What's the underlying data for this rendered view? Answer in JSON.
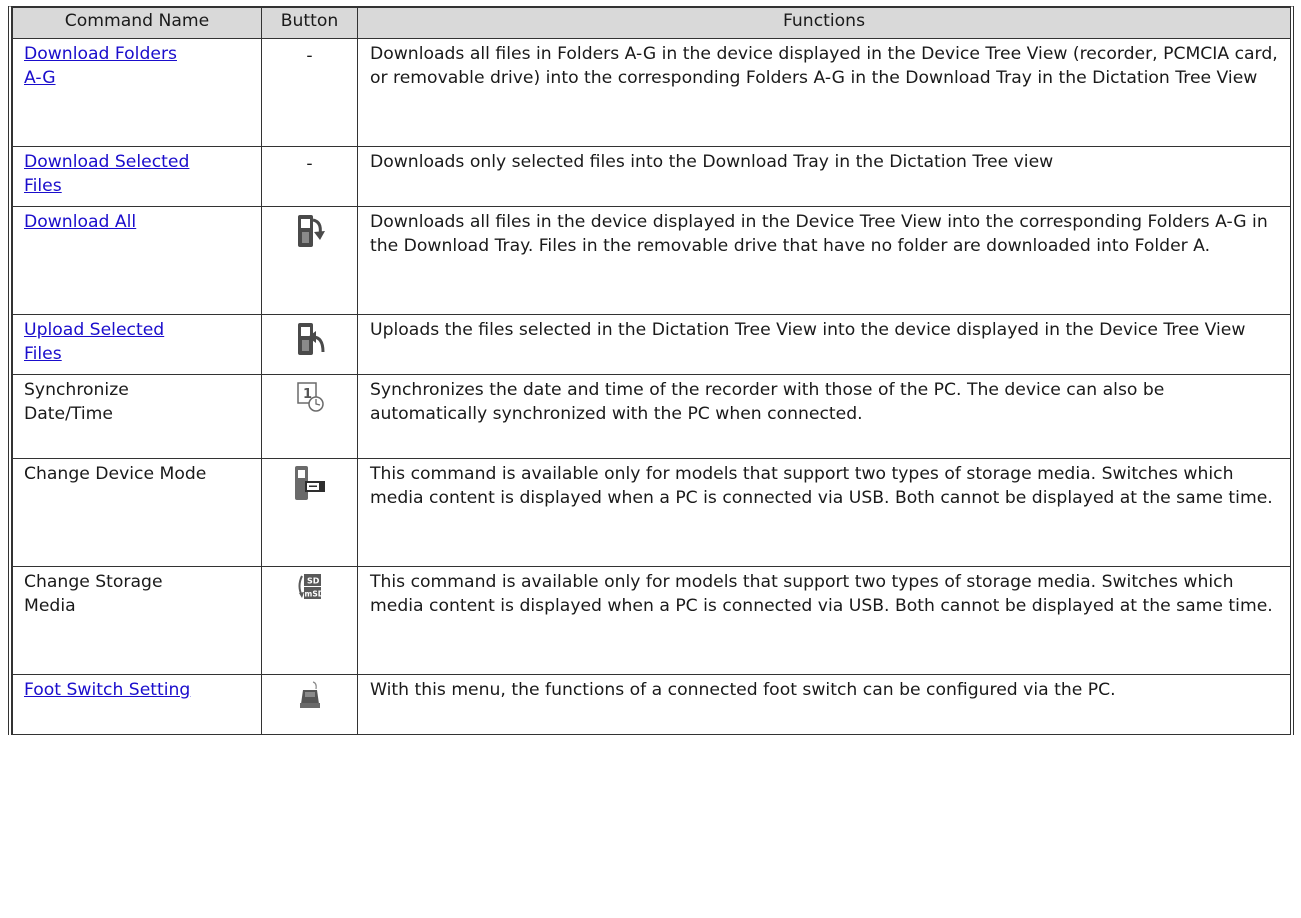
{
  "headers": {
    "command": "Command Name",
    "button": "Button",
    "functions": "Functions"
  },
  "rows": [
    {
      "name": "Download Folders A-G",
      "name_lines": [
        "Download Folders ",
        "A-G"
      ],
      "link": true,
      "button": "-",
      "icon": "none",
      "function": "Downloads all files in Folders A-G in the device displayed in the Device Tree View (recorder, PCMCIA card, or removable drive) into the corresponding Folders A-G in the Download Tray in the Dictation Tree View"
    },
    {
      "name": "Download Selected Files",
      "name_lines": [
        "Download Selected ",
        "Files"
      ],
      "link": true,
      "button": "-",
      "icon": "none",
      "function": "Downloads only selected files into the Download Tray in the Dictation Tree view"
    },
    {
      "name": "Download All",
      "name_lines": [
        "Download All"
      ],
      "link": true,
      "button": "",
      "icon": "download-all-icon",
      "function": "Downloads all files in the device displayed in the Device Tree View into the corresponding Folders A-G in the Download Tray. Files in the removable drive that have no folder are downloaded into Folder A."
    },
    {
      "name": "Upload Selected Files",
      "name_lines": [
        "Upload Selected ",
        "Files"
      ],
      "link": true,
      "button": "",
      "icon": "upload-selected-icon",
      "function": "Uploads the files selected in the Dictation Tree View into the device displayed in the Device Tree View"
    },
    {
      "name": "Synchronize Date/Time",
      "name_lines": [
        "Synchronize",
        "Date/Time"
      ],
      "link": false,
      "button": "",
      "icon": "sync-date-time-icon",
      "function": "Synchronizes the date and time of the recorder with those of the PC. The device can also be automatically synchronized with the PC when connected."
    },
    {
      "name": "Change Device Mode",
      "name_lines": [
        "Change Device Mode"
      ],
      "link": false,
      "button": "",
      "icon": "change-device-mode-icon",
      "function": "This command is available only for models that support two types of storage media. Switches which media content is displayed when a PC is connected via USB. Both cannot be displayed at the same time."
    },
    {
      "name": "Change Storage Media",
      "name_lines": [
        "Change Storage",
        "Media"
      ],
      "link": false,
      "button": "",
      "icon": "change-storage-media-icon",
      "icon_text": {
        "top": "SD",
        "bottom": "mSD"
      },
      "function": "This command is available only for models that support two types of storage media. Switches which media content is displayed when a PC is connected via USB. Both cannot be displayed at the same time."
    },
    {
      "name": "Foot Switch Setting",
      "name_lines": [
        "Foot Switch Setting"
      ],
      "link": true,
      "button": "",
      "icon": "foot-switch-icon",
      "function": "With this menu, the functions of a connected foot switch can be configured via the PC."
    }
  ],
  "colors": {
    "link": "#1a0dcc",
    "header_bg": "#d9d9d9",
    "border": "#333333",
    "icon_dark": "#4a4a4a"
  }
}
